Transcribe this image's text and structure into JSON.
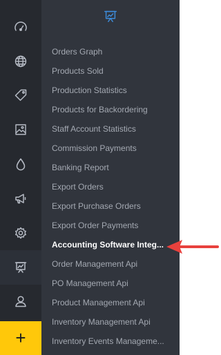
{
  "colors": {
    "rail_bg": "#26292f",
    "panel_bg": "#31353d",
    "icon": "#b7bcc6",
    "accent": "#3d8bd9",
    "add_bg": "#ffc80a",
    "menu_text": "#a4a9b2",
    "menu_active_text": "#ffffff",
    "annotation_arrow": "#e8413d"
  },
  "rail": {
    "items": [
      {
        "icon": "dashboard-gauge-icon"
      },
      {
        "icon": "globe-icon"
      },
      {
        "icon": "tag-icon"
      },
      {
        "icon": "image-icon"
      },
      {
        "icon": "droplet-icon"
      },
      {
        "icon": "megaphone-icon"
      },
      {
        "icon": "gear-icon"
      },
      {
        "icon": "presentation-chart-icon",
        "active": true
      },
      {
        "icon": "user-icon"
      }
    ],
    "add_label": "+"
  },
  "panel": {
    "header_icon": "presentation-chart-icon",
    "items": [
      {
        "label": "Orders Graph"
      },
      {
        "label": "Products Sold"
      },
      {
        "label": "Production Statistics"
      },
      {
        "label": "Products for Backordering"
      },
      {
        "label": "Staff Account Statistics"
      },
      {
        "label": "Commission Payments"
      },
      {
        "label": "Banking Report"
      },
      {
        "label": "Export Orders"
      },
      {
        "label": "Export Purchase Orders"
      },
      {
        "label": "Export Order Payments"
      },
      {
        "label": "Accounting Software Integ...",
        "active": true
      },
      {
        "label": "Order Management Api"
      },
      {
        "label": "PO Management Api"
      },
      {
        "label": "Product Management Api"
      },
      {
        "label": "Inventory Management Api"
      },
      {
        "label": "Inventory Events Manageme..."
      }
    ]
  },
  "annotation": {
    "type": "red-arrow",
    "points_to": "Accounting Software Integ..."
  }
}
